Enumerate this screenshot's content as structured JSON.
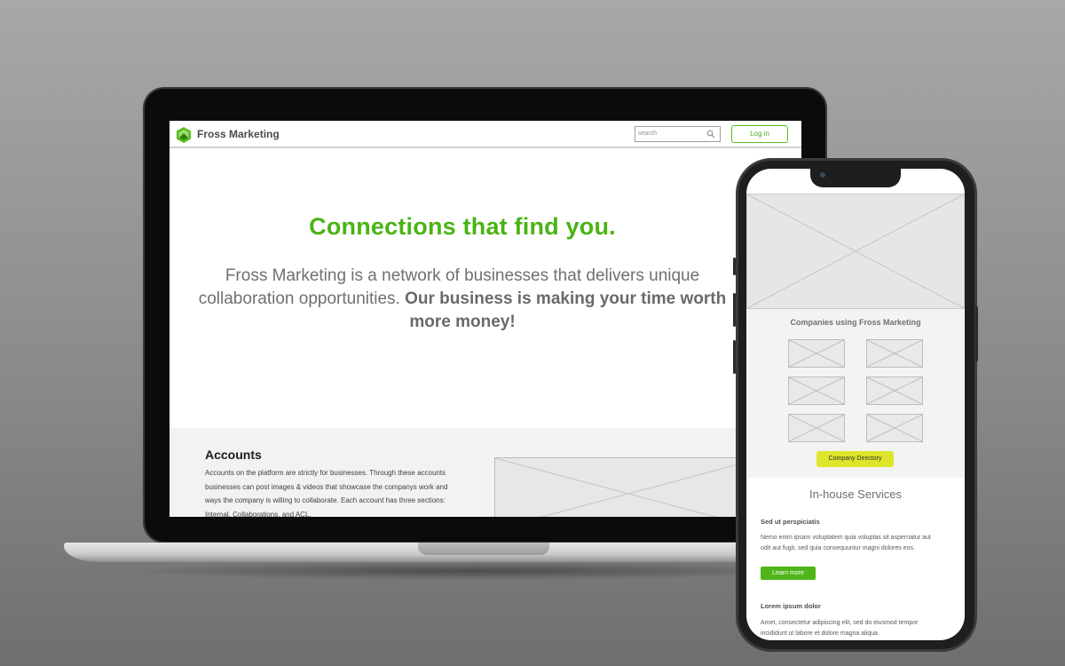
{
  "desktop": {
    "brand": "Fross Marketing",
    "search": {
      "placeholder": "search"
    },
    "login_label": "Log in",
    "hero": {
      "title": "Connections that find you.",
      "body_plain": "Fross Marketing is a network of businesses that delivers unique collaboration opportunities. ",
      "body_bold": "Our business is making your time worth more money!"
    },
    "accounts": {
      "title": "Accounts",
      "text": "Accounts on the platform are strictly for businesses. Through these accounts businesses can post images & videos that showcase the companys work and ways the company is willing to collaborate. Each account has three sections: Internal, Collaborations, and ACL."
    }
  },
  "mobile": {
    "companies_title": "Companies using Fross Marketing",
    "directory_button": "Company Directory",
    "services_title": "In-house Services",
    "services": [
      {
        "heading": "Sed ut perspiciatis",
        "body": "Nemo enim ipsam voluptatem quia voluptas sit aspernatur aut odit aut fugit, sed quia consequuntur magni dolores eos.",
        "button": "Learn more"
      },
      {
        "heading": "Lorem ipsum dolor",
        "body": "Amet, consectetur adipiscing elit, sed do eiusmod tempor incididunt ut labore et dolore magna aliqua."
      }
    ]
  },
  "colors": {
    "brand_green": "#4ab314",
    "button_yellow": "#dde62b",
    "background_gray": "#8a8b8b"
  },
  "icons": [
    "logo-icon",
    "search-icon"
  ]
}
